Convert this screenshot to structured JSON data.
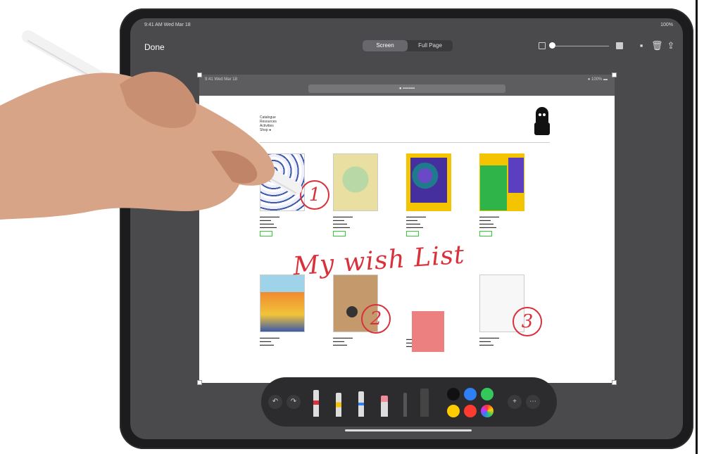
{
  "status": {
    "time": "9:41 AM  Wed Mar 18",
    "battery": "100%"
  },
  "toolbar": {
    "done": "Done",
    "segments": [
      {
        "label": "Screen",
        "active": true
      },
      {
        "label": "Full Page",
        "active": false
      }
    ],
    "icons": [
      "crop-icon",
      "trash-icon",
      "share-icon"
    ]
  },
  "browser": {
    "url": "● ▪▪▪▪▪▪▪▪",
    "left": "9:41  Wed Mar 18",
    "right": "● 100% ▬"
  },
  "site": {
    "nav": [
      "Catalogue",
      "Resources",
      "Activities",
      "Shop ●"
    ]
  },
  "annotation": {
    "text": "My wish List",
    "numbers": [
      "1",
      "2",
      "3"
    ],
    "color": "#d9313b"
  },
  "colors": {
    "black": "#111111",
    "blue": "#2f7ff6",
    "green": "#34c759",
    "yellow": "#ffcc00",
    "red": "#ff3b30"
  }
}
